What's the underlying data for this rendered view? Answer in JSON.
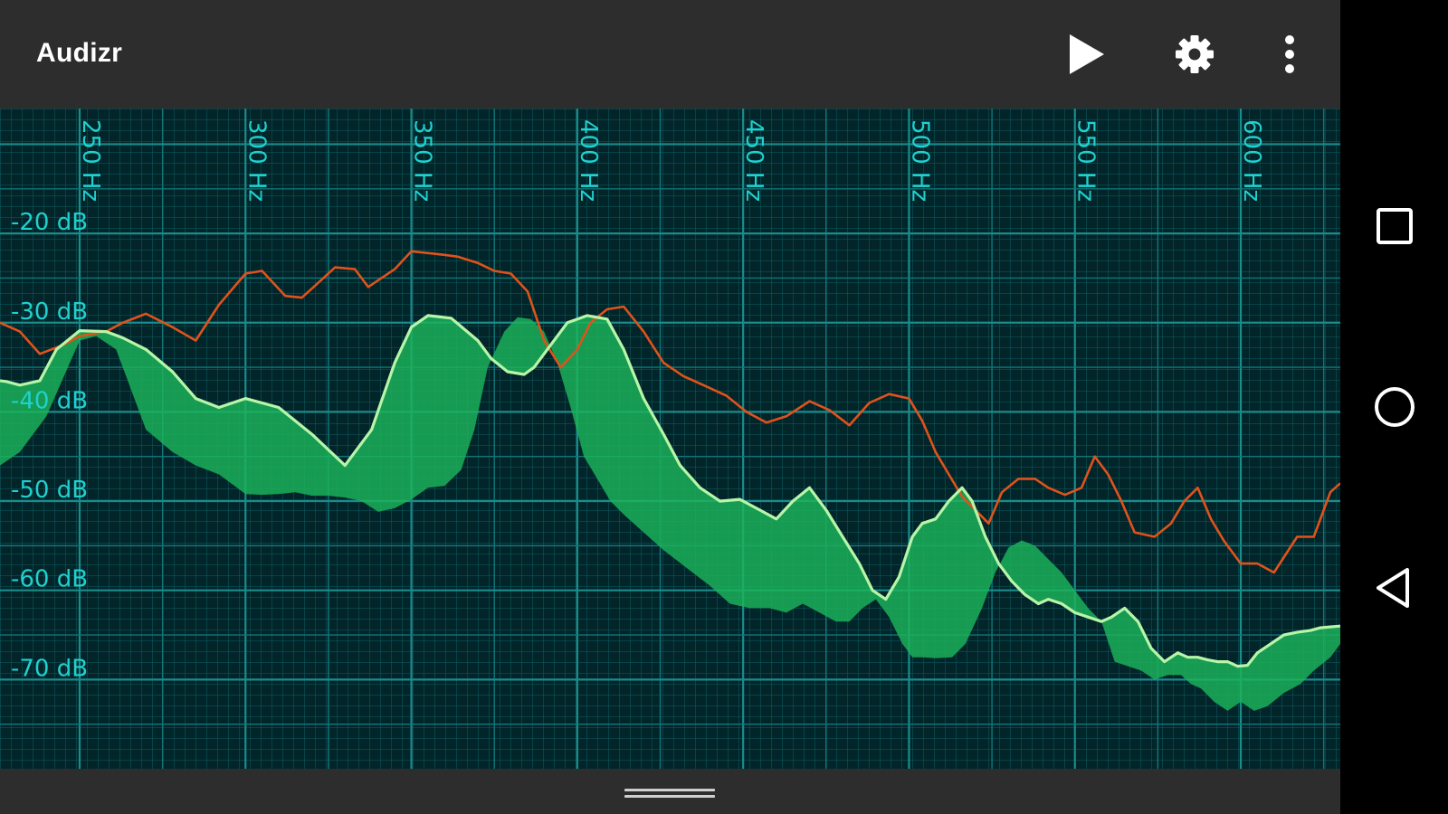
{
  "app_bar": {
    "title": "Audizr",
    "actions": [
      "play-icon",
      "gear-icon",
      "more-vert-icon"
    ]
  },
  "navigation": [
    "recents-icon",
    "home-icon",
    "back-icon"
  ],
  "colors": {
    "app_bar": "#2d2d2d",
    "plot_background": "#02252a",
    "grid": "#1a8c8c",
    "axis_label": "#1fd1cf",
    "peak_line": "#e0521b",
    "spectrum_line": "#b8f5a8",
    "spectrum_fill": "#1cb45a"
  },
  "chart_data": {
    "type": "line",
    "x_unit": "Hz",
    "y_unit": "dB",
    "x_ticks": [
      {
        "value": 250,
        "label": "250 Hz"
      },
      {
        "value": 300,
        "label": "300 Hz"
      },
      {
        "value": 350,
        "label": "350 Hz"
      },
      {
        "value": 400,
        "label": "400 Hz"
      },
      {
        "value": 450,
        "label": "450 Hz"
      },
      {
        "value": 500,
        "label": "500 Hz"
      },
      {
        "value": 550,
        "label": "550 Hz"
      },
      {
        "value": 600,
        "label": "600 Hz"
      }
    ],
    "y_ticks": [
      {
        "value": -20,
        "label": "-20 dB"
      },
      {
        "value": -30,
        "label": "-30 dB"
      },
      {
        "value": -40,
        "label": "-40 dB"
      },
      {
        "value": -50,
        "label": "-50 dB"
      },
      {
        "value": -60,
        "label": "-60 dB"
      },
      {
        "value": -70,
        "label": "-70 dB"
      }
    ],
    "xlim": [
      226,
      630
    ],
    "ylim": [
      -80,
      -6
    ],
    "grid": true,
    "series": [
      {
        "role": "peak-hold",
        "x": [
          226,
          232,
          238,
          245,
          250,
          258,
          263,
          270,
          278,
          285,
          292,
          300,
          305,
          312,
          317,
          322,
          327,
          333,
          337,
          345,
          350,
          355,
          360,
          364,
          370,
          375,
          380,
          385,
          390,
          395,
          400,
          404,
          409,
          414,
          420,
          426,
          432,
          438,
          445,
          451,
          457,
          463,
          470,
          476,
          482,
          488,
          494,
          500,
          504,
          508,
          512,
          516,
          520,
          524,
          528,
          533,
          538,
          542,
          547,
          552,
          556,
          560,
          564,
          568,
          574,
          579,
          583,
          587,
          591,
          595,
          600,
          605,
          610,
          617,
          622,
          627,
          630
        ],
        "y": [
          -30,
          -31,
          -33.5,
          -32.5,
          -31.5,
          -31,
          -30,
          -29,
          -30.5,
          -32,
          -28,
          -24.5,
          -24.2,
          -27,
          -27.2,
          -25.5,
          -23.8,
          -24,
          -26,
          -24,
          -22,
          -22.2,
          -22.4,
          -22.6,
          -23.3,
          -24.2,
          -24.5,
          -26.5,
          -32,
          -35,
          -33,
          -30,
          -28.5,
          -28.2,
          -31,
          -34.5,
          -36,
          -37,
          -38.2,
          -40,
          -41.2,
          -40.5,
          -38.8,
          -39.8,
          -41.5,
          -39,
          -38,
          -38.5,
          -41,
          -44.5,
          -47,
          -49.5,
          -51,
          -52.5,
          -49,
          -47.5,
          -47.5,
          -48.5,
          -49.3,
          -48.5,
          -45,
          -47,
          -50,
          -53.5,
          -54,
          -52.5,
          -50,
          -48.5,
          -52,
          -54.5,
          -57,
          -57,
          -58,
          -54,
          -54,
          -49,
          -48
        ]
      },
      {
        "role": "spectrum",
        "x": [
          226,
          228,
          232,
          238,
          243,
          250,
          258,
          263,
          270,
          278,
          285,
          292,
          300,
          310,
          320,
          330,
          338,
          345,
          350,
          355,
          362,
          370,
          374,
          379,
          384,
          387,
          392,
          397,
          403,
          409,
          414,
          420,
          426,
          431,
          437,
          443,
          449,
          455,
          460,
          465,
          470,
          475,
          480,
          485,
          489,
          493,
          497,
          501,
          504,
          508,
          512,
          516,
          519,
          523,
          527,
          531,
          535,
          539,
          542,
          546,
          550,
          554,
          558,
          561,
          565,
          569,
          573,
          577,
          581,
          584,
          587,
          590,
          593,
          596,
          599,
          602,
          605,
          609,
          613,
          617,
          621,
          624,
          627,
          630
        ],
        "y": [
          -36.5,
          -36.6,
          -37,
          -36.5,
          -33,
          -30.9,
          -31,
          -31.7,
          -33,
          -35.5,
          -38.5,
          -39.5,
          -38.5,
          -39.5,
          -42.5,
          -46,
          -42,
          -34.5,
          -30.5,
          -29.2,
          -29.5,
          -32,
          -34,
          -35.5,
          -35.8,
          -35,
          -32.5,
          -30,
          -29.2,
          -29.6,
          -33,
          -38.5,
          -42.5,
          -46,
          -48.5,
          -50,
          -49.8,
          -51,
          -52,
          -50,
          -48.5,
          -51,
          -54,
          -57,
          -60,
          -61,
          -58.5,
          -54,
          -52.5,
          -52,
          -50,
          -48.5,
          -50,
          -54,
          -57,
          -59,
          -60.5,
          -61.5,
          -61,
          -61.5,
          -62.5,
          -63,
          -63.5,
          -63,
          -62,
          -63.5,
          -66.5,
          -68,
          -67,
          -67.5,
          -67.5,
          -67.8,
          -68,
          -68,
          -68.5,
          -68.4,
          -67,
          -66,
          -65,
          -64.7,
          -64.5,
          -64.2,
          -64.1,
          -64
        ]
      },
      {
        "role": "spectrum-floor",
        "x": [
          226,
          232,
          240,
          250,
          255,
          261,
          265,
          270,
          278,
          285,
          292,
          300,
          305,
          310,
          315,
          320,
          325,
          330,
          335,
          340,
          345,
          350,
          355,
          360,
          365,
          369,
          373,
          378,
          382,
          386,
          390,
          394,
          398,
          402,
          406,
          410,
          414,
          420,
          426,
          433,
          440,
          446,
          452,
          458,
          463,
          468,
          473,
          478,
          482,
          486,
          490,
          494,
          498,
          501,
          504,
          508,
          513,
          517,
          522,
          526,
          530,
          534,
          538,
          542,
          546,
          550,
          554,
          558,
          562,
          566,
          570,
          574,
          578,
          582,
          585,
          588,
          592,
          596,
          600,
          604,
          608,
          613,
          618,
          622,
          627,
          630
        ],
        "y": [
          -46,
          -44.5,
          -40.5,
          -32,
          -31.5,
          -33,
          -37,
          -42,
          -44.5,
          -46,
          -47,
          -49.2,
          -49.3,
          -49.2,
          -49,
          -49.4,
          -49.4,
          -49.6,
          -50,
          -51.2,
          -50.8,
          -49.8,
          -48.5,
          -48.3,
          -46.5,
          -42,
          -35,
          -31,
          -29.4,
          -29.6,
          -31,
          -34.5,
          -39.5,
          -45,
          -47.5,
          -50,
          -51.5,
          -53.5,
          -55.5,
          -57.5,
          -59.5,
          -61.5,
          -62,
          -62,
          -62.5,
          -61.5,
          -62.5,
          -63.5,
          -63.5,
          -62,
          -61,
          -63,
          -66,
          -67.5,
          -67.5,
          -67.6,
          -67.5,
          -66,
          -62,
          -58,
          -55.2,
          -54.4,
          -55,
          -56.5,
          -58,
          -60,
          -62,
          -63.5,
          -68,
          -68.5,
          -69,
          -70,
          -69.5,
          -69.5,
          -70.5,
          -71,
          -72.5,
          -73.5,
          -72.5,
          -73.5,
          -73,
          -71.5,
          -70.5,
          -69,
          -67.5,
          -66
        ]
      }
    ]
  }
}
